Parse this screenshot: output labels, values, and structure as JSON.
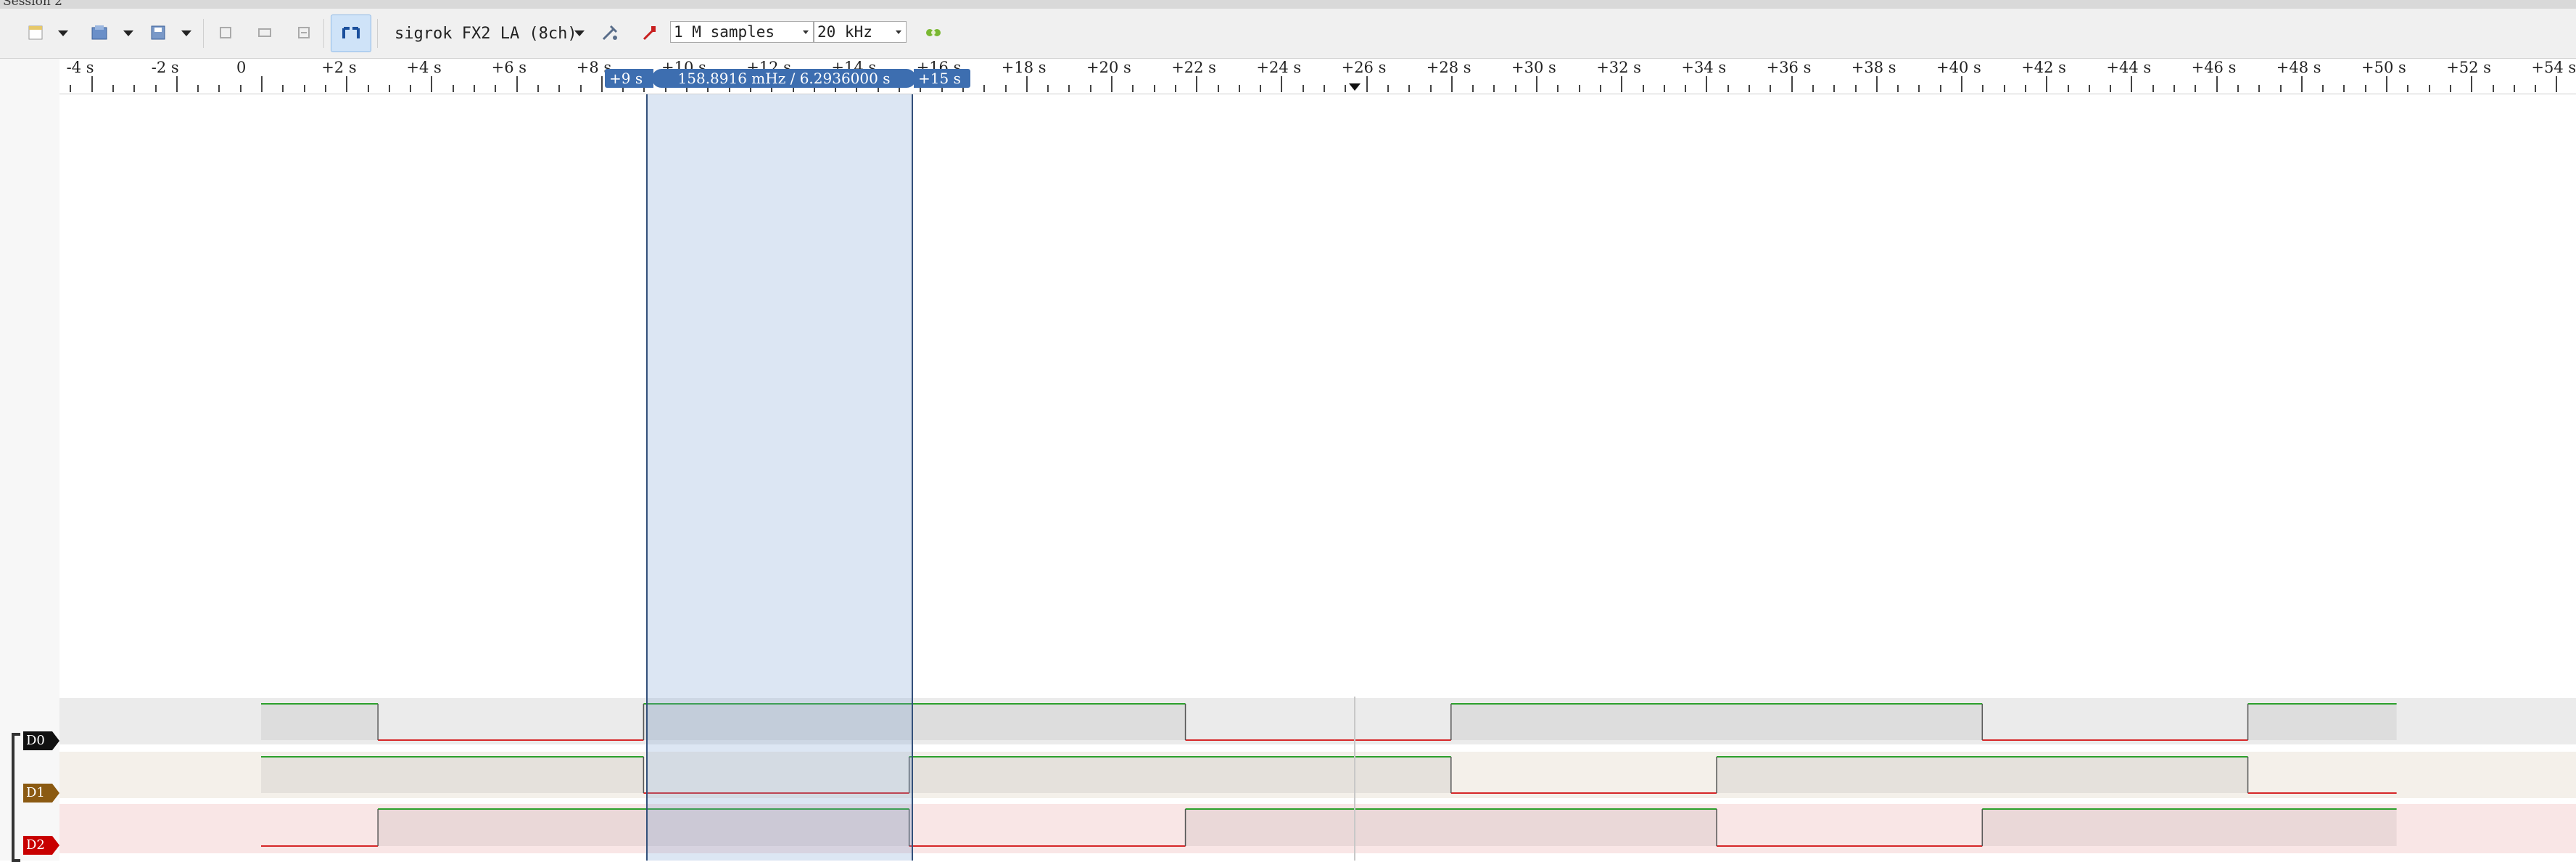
{
  "window": {
    "title": "Session 2"
  },
  "toolbar": {
    "device": "sigrok FX2 LA (8ch)",
    "sample_count": "1 M samples",
    "sample_rate": "20 kHz",
    "icons": [
      "new-session-icon",
      "open-icon",
      "save-icon",
      "save-selection-icon",
      "zoom-fit-icon",
      "zoom-one-icon",
      "zoom-in-icon",
      "show-cursors-icon",
      "configure-device-icon",
      "probe-icon",
      "run-icon"
    ]
  },
  "ruler": {
    "labels": [
      "-4 s",
      "-2 s",
      "0",
      "+2 s",
      "+4 s",
      "+6 s",
      "+8 s",
      "+10 s",
      "+12 s",
      "+14 s",
      "+16 s",
      "+18 s",
      "+20 s",
      "+22 s",
      "+24 s",
      "+26 s",
      "+28 s",
      "+30 s",
      "+32 s",
      "+34 s",
      "+36 s",
      "+38 s",
      "+40 s",
      "+42 s",
      "+44 s",
      "+46 s",
      "+48 s",
      "+50 s",
      "+52 s",
      "+54 s"
    ]
  },
  "cursors": {
    "left_label": "+9 s",
    "right_label": "+15 s",
    "measurement": "158.8916 mHz / 6.2936000 s"
  },
  "channels": [
    {
      "name": "D0",
      "color": "#111111",
      "transitions": [
        [
          0,
          1
        ],
        [
          2.75,
          0
        ],
        [
          9,
          1
        ],
        [
          21.75,
          0
        ],
        [
          28,
          1
        ],
        [
          40.5,
          0
        ],
        [
          46.75,
          1
        ],
        [
          50.25,
          1
        ]
      ]
    },
    {
      "name": "D1",
      "color": "#8b5a12",
      "transitions": [
        [
          0,
          1
        ],
        [
          9,
          0
        ],
        [
          15.25,
          1
        ],
        [
          28,
          0
        ],
        [
          34.25,
          1
        ],
        [
          46.75,
          0
        ],
        [
          50.25,
          0
        ]
      ]
    },
    {
      "name": "D2",
      "color": "#c80000",
      "transitions": [
        [
          0,
          0
        ],
        [
          2.75,
          1
        ],
        [
          15.25,
          0
        ],
        [
          21.75,
          1
        ],
        [
          34.25,
          0
        ],
        [
          40.5,
          1
        ],
        [
          50.25,
          1
        ]
      ]
    }
  ],
  "colors": {
    "accent": "#3d6eb0",
    "high": "#2ca02c",
    "low": "#d62728"
  }
}
